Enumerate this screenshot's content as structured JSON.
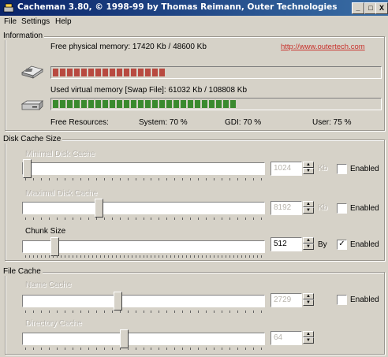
{
  "window": {
    "title": "Cacheman 3.80, © 1998-99 by Thomas Reimann, Outer Technologies",
    "min_glyph": "_",
    "max_glyph": "□",
    "close_glyph": "X",
    "title_color": "#0a246a"
  },
  "menu": [
    {
      "label": "File",
      "key": "F"
    },
    {
      "label": "Settings",
      "key": "S"
    },
    {
      "label": "Help",
      "key": "H"
    }
  ],
  "information": {
    "legend": "Information",
    "link": "http://www.outertech.com",
    "physical_label": "Free physical memory: 17420 Kb / 48600 Kb",
    "physical_fraction": 0.358,
    "physical_color": "#b84a40",
    "virtual_label": "Used virtual memory [Swap File]: 61032 Kb / 108808 Kb",
    "virtual_fraction": 0.561,
    "virtual_color": "#3a8a2e",
    "free_resources_label": "Free Resources:",
    "system_label": "System: 70 %",
    "gdi_label": "GDI: 70 %",
    "user_label": "User: 75 %"
  },
  "disk_cache": {
    "legend": "Disk Cache Size",
    "min_label": "Minimal Disk Cache",
    "min_value": "1024",
    "min_unit": "Kb",
    "min_fraction": 0.0,
    "min_enabled_label": "Enabled",
    "min_enabled": false,
    "max_label": "Maximal Disk Cache",
    "max_value": "8192",
    "max_unit": "Kb",
    "max_fraction": 0.31,
    "max_enabled_label": "Enabled",
    "max_enabled": false,
    "chunk_label": "Chunk Size",
    "chunk_value": "512",
    "chunk_unit": "By",
    "chunk_fraction": 0.12,
    "chunk_enabled_label": "Enabled",
    "chunk_enabled": true
  },
  "file_cache": {
    "legend": "File Cache",
    "name_label": "Name Cache",
    "name_value": "2729",
    "name_fraction": 0.39,
    "name_enabled_label": "Enabled",
    "name_enabled": false,
    "dir_label": "Directory Cache",
    "dir_value": "64",
    "dir_fraction": 0.42
  }
}
